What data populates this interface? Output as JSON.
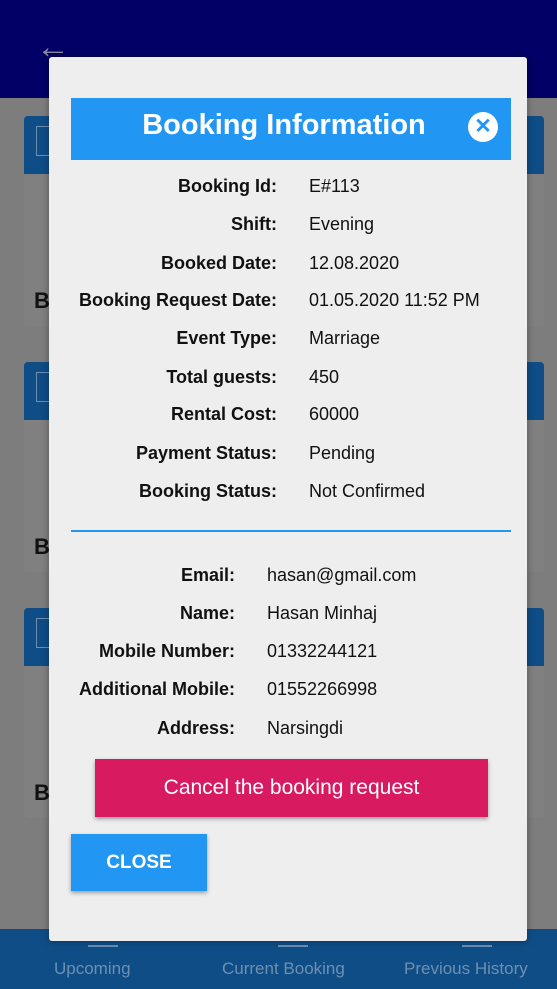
{
  "nav": {
    "items": [
      {
        "label": "Upcoming"
      },
      {
        "label": "Current Booking"
      },
      {
        "label": "Previous History"
      }
    ]
  },
  "background": {
    "card_letters": [
      "B",
      "B",
      "B"
    ]
  },
  "dialog": {
    "title": "Booking Information",
    "booking": [
      {
        "label": "Booking Id:",
        "value": "E#113"
      },
      {
        "label": "Shift:",
        "value": "Evening"
      },
      {
        "label": "Booked Date:",
        "value": "12.08.2020"
      },
      {
        "label": "Booking Request Date:",
        "value": "01.05.2020 11:52 PM"
      },
      {
        "label": "Event Type:",
        "value": "Marriage"
      },
      {
        "label": "Total guests:",
        "value": "450"
      },
      {
        "label": "Rental Cost:",
        "value": "60000"
      },
      {
        "label": "Payment Status:",
        "value": "Pending"
      },
      {
        "label": "Booking Status:",
        "value": "Not Confirmed"
      }
    ],
    "customer": [
      {
        "label": "Email:",
        "value": "hasan@gmail.com"
      },
      {
        "label": "Name:",
        "value": "Hasan Minhaj"
      },
      {
        "label": "Mobile Number:",
        "value": "01332244121"
      },
      {
        "label": "Additional Mobile:",
        "value": "01552266998"
      },
      {
        "label": "Address:",
        "value": "Narsingdi"
      }
    ],
    "cancel_label": "Cancel the booking request",
    "close_label": "CLOSE"
  },
  "colors": {
    "header": "#2196f3",
    "cancel": "#d81b60",
    "topbar": "#020066"
  }
}
